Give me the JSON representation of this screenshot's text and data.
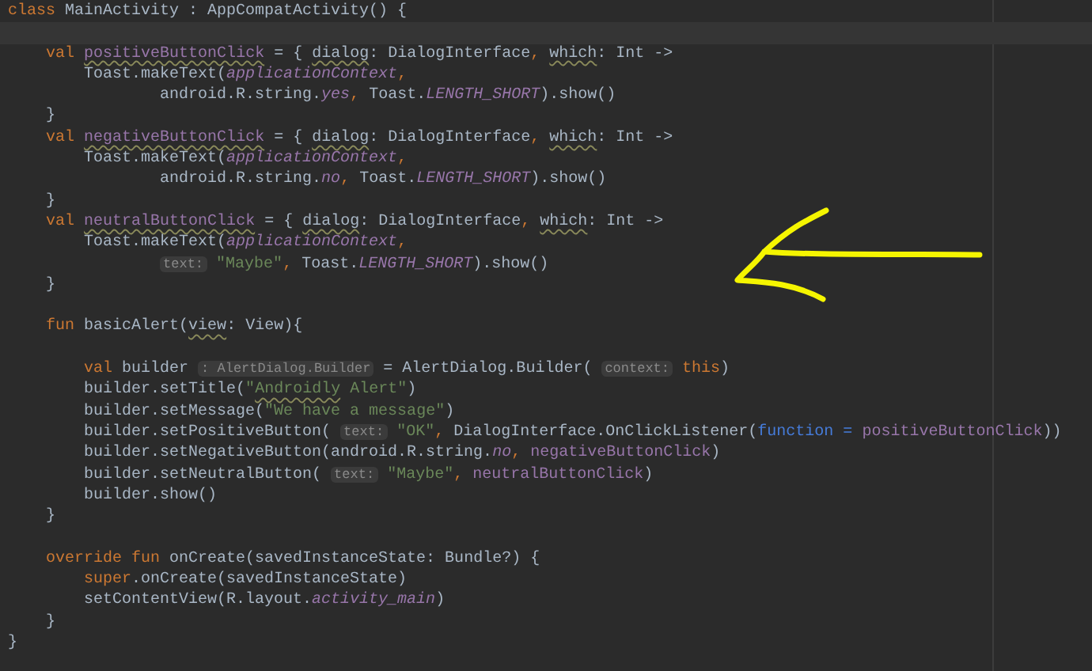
{
  "editor": {
    "lines": [
      {
        "kind": "code",
        "tokens": [
          {
            "kind": "keyword",
            "text": "class",
            "typo": false
          },
          {
            "kind": "plain",
            "text": " MainActivity : AppCompatActivity() {",
            "typo": false
          }
        ]
      },
      {
        "kind": "current"
      },
      {
        "kind": "code",
        "tokens": [
          {
            "kind": "keyword",
            "text": "    val",
            "typo": false
          },
          {
            "kind": "field",
            "text": " positiveButtonClick",
            "typo": true
          },
          {
            "kind": "plain",
            "text": " = { ",
            "typo": false
          },
          {
            "kind": "plain",
            "text": "dialog",
            "typo": true
          },
          {
            "kind": "plain",
            "text": ": DialogInterface",
            "typo": false
          },
          {
            "kind": "keyword",
            "text": ", ",
            "typo": false
          },
          {
            "kind": "plain",
            "text": "which",
            "typo": true
          },
          {
            "kind": "plain",
            "text": ": Int ->",
            "typo": false
          }
        ]
      },
      {
        "kind": "code",
        "tokens": [
          {
            "kind": "plain",
            "text": "        Toast.makeText(",
            "typo": false
          },
          {
            "kind": "field_italic",
            "text": "applicationContext",
            "typo": false
          },
          {
            "kind": "keyword",
            "text": ",",
            "typo": false
          }
        ]
      },
      {
        "kind": "code",
        "tokens": [
          {
            "kind": "plain",
            "text": "                android.R.string.",
            "typo": false
          },
          {
            "kind": "field_italic",
            "text": "yes",
            "typo": false
          },
          {
            "kind": "keyword",
            "text": ",",
            "typo": false
          },
          {
            "kind": "plain",
            "text": " Toast.",
            "typo": false
          },
          {
            "kind": "field_italic",
            "text": "LENGTH_SHORT",
            "typo": false
          },
          {
            "kind": "plain",
            "text": ").show()",
            "typo": false
          }
        ]
      },
      {
        "kind": "code",
        "tokens": [
          {
            "kind": "plain",
            "text": "    }",
            "typo": false
          }
        ]
      },
      {
        "kind": "code",
        "tokens": [
          {
            "kind": "keyword",
            "text": "    val",
            "typo": false
          },
          {
            "kind": "field",
            "text": " negativeButtonClick",
            "typo": true
          },
          {
            "kind": "plain",
            "text": " = { ",
            "typo": false
          },
          {
            "kind": "plain",
            "text": "dialog",
            "typo": true
          },
          {
            "kind": "plain",
            "text": ": DialogInterface",
            "typo": false
          },
          {
            "kind": "keyword",
            "text": ", ",
            "typo": false
          },
          {
            "kind": "plain",
            "text": "which",
            "typo": true
          },
          {
            "kind": "plain",
            "text": ": Int ->",
            "typo": false
          }
        ]
      },
      {
        "kind": "code",
        "tokens": [
          {
            "kind": "plain",
            "text": "        Toast.makeText(",
            "typo": false
          },
          {
            "kind": "field_italic",
            "text": "applicationContext",
            "typo": false
          },
          {
            "kind": "keyword",
            "text": ",",
            "typo": false
          }
        ]
      },
      {
        "kind": "code",
        "tokens": [
          {
            "kind": "plain",
            "text": "                android.R.string.",
            "typo": false
          },
          {
            "kind": "field_italic",
            "text": "no",
            "typo": false
          },
          {
            "kind": "keyword",
            "text": ",",
            "typo": false
          },
          {
            "kind": "plain",
            "text": " Toast.",
            "typo": false
          },
          {
            "kind": "field_italic",
            "text": "LENGTH_SHORT",
            "typo": false
          },
          {
            "kind": "plain",
            "text": ").show()",
            "typo": false
          }
        ]
      },
      {
        "kind": "code",
        "tokens": [
          {
            "kind": "plain",
            "text": "    }",
            "typo": false
          }
        ]
      },
      {
        "kind": "code",
        "tokens": [
          {
            "kind": "keyword",
            "text": "    val",
            "typo": false
          },
          {
            "kind": "field",
            "text": " neutralButtonClick",
            "typo": true
          },
          {
            "kind": "plain",
            "text": " = { ",
            "typo": false
          },
          {
            "kind": "plain",
            "text": "dialog",
            "typo": true
          },
          {
            "kind": "plain",
            "text": ": DialogInterface",
            "typo": false
          },
          {
            "kind": "keyword",
            "text": ", ",
            "typo": false
          },
          {
            "kind": "plain",
            "text": "which",
            "typo": true
          },
          {
            "kind": "plain",
            "text": ": Int ->",
            "typo": false
          }
        ]
      },
      {
        "kind": "code",
        "tokens": [
          {
            "kind": "plain",
            "text": "        Toast.makeText(",
            "typo": false
          },
          {
            "kind": "field_italic",
            "text": "applicationContext",
            "typo": false
          },
          {
            "kind": "keyword",
            "text": ",",
            "typo": false
          }
        ]
      },
      {
        "kind": "code",
        "tokens": [
          {
            "kind": "hint",
            "text": "                text:",
            "typo": false
          },
          {
            "kind": "string",
            "text": " \"Maybe\"",
            "typo": false
          },
          {
            "kind": "keyword",
            "text": ",",
            "typo": false
          },
          {
            "kind": "plain",
            "text": " Toast.",
            "typo": false
          },
          {
            "kind": "field_italic",
            "text": "LENGTH_SHORT",
            "typo": false
          },
          {
            "kind": "plain",
            "text": ").show()",
            "typo": false
          }
        ]
      },
      {
        "kind": "code",
        "tokens": [
          {
            "kind": "plain",
            "text": "    }",
            "typo": false
          }
        ]
      },
      {
        "kind": "blank"
      },
      {
        "kind": "code",
        "tokens": [
          {
            "kind": "keyword",
            "text": "    fun",
            "typo": false
          },
          {
            "kind": "plain",
            "text": " basicAlert(",
            "typo": false
          },
          {
            "kind": "plain",
            "text": "view",
            "typo": true
          },
          {
            "kind": "plain",
            "text": ": View){",
            "typo": false
          }
        ]
      },
      {
        "kind": "blank"
      },
      {
        "kind": "code",
        "tokens": [
          {
            "kind": "keyword",
            "text": "        val",
            "typo": false
          },
          {
            "kind": "plain",
            "text": " builder ",
            "typo": false
          },
          {
            "kind": "hint",
            "text": ": AlertDialog.Builder",
            "typo": false
          },
          {
            "kind": "plain",
            "text": " = AlertDialog.Builder( ",
            "typo": false
          },
          {
            "kind": "hint",
            "text": "context:",
            "typo": false
          },
          {
            "kind": "keyword",
            "text": " this",
            "typo": false
          },
          {
            "kind": "plain",
            "text": ")",
            "typo": false
          }
        ]
      },
      {
        "kind": "code",
        "tokens": [
          {
            "kind": "plain",
            "text": "        builder.setTitle(",
            "typo": false
          },
          {
            "kind": "string",
            "text": "\"",
            "typo": false
          },
          {
            "kind": "string",
            "text": "Androidly",
            "typo": true
          },
          {
            "kind": "string",
            "text": " Alert\"",
            "typo": false
          },
          {
            "kind": "plain",
            "text": ")",
            "typo": false
          }
        ]
      },
      {
        "kind": "code",
        "tokens": [
          {
            "kind": "plain",
            "text": "        builder.setMessage(",
            "typo": false
          },
          {
            "kind": "string",
            "text": "\"We have a message\"",
            "typo": false
          },
          {
            "kind": "plain",
            "text": ")",
            "typo": false
          }
        ]
      },
      {
        "kind": "code",
        "tokens": [
          {
            "kind": "plain",
            "text": "        builder.setPositiveButton( ",
            "typo": false
          },
          {
            "kind": "hint",
            "text": "text:",
            "typo": false
          },
          {
            "kind": "string",
            "text": " \"OK\"",
            "typo": false
          },
          {
            "kind": "keyword",
            "text": ",",
            "typo": false
          },
          {
            "kind": "plain",
            "text": " DialogInterface.OnClickListener(",
            "typo": false
          },
          {
            "kind": "param",
            "text": "function =",
            "typo": false
          },
          {
            "kind": "field",
            "text": " positiveButtonClick",
            "typo": false
          },
          {
            "kind": "plain",
            "text": "))",
            "typo": false
          }
        ]
      },
      {
        "kind": "code",
        "tokens": [
          {
            "kind": "plain",
            "text": "        builder.setNegativeButton(android.R.string.",
            "typo": false
          },
          {
            "kind": "field_italic",
            "text": "no",
            "typo": false
          },
          {
            "kind": "keyword",
            "text": ",",
            "typo": false
          },
          {
            "kind": "field",
            "text": " negativeButtonClick",
            "typo": false
          },
          {
            "kind": "plain",
            "text": ")",
            "typo": false
          }
        ]
      },
      {
        "kind": "code",
        "tokens": [
          {
            "kind": "plain",
            "text": "        builder.setNeutralButton( ",
            "typo": false
          },
          {
            "kind": "hint",
            "text": "text:",
            "typo": false
          },
          {
            "kind": "string",
            "text": " \"Maybe\"",
            "typo": false
          },
          {
            "kind": "keyword",
            "text": ",",
            "typo": false
          },
          {
            "kind": "field",
            "text": " neutralButtonClick",
            "typo": false
          },
          {
            "kind": "plain",
            "text": ")",
            "typo": false
          }
        ]
      },
      {
        "kind": "code",
        "tokens": [
          {
            "kind": "plain",
            "text": "        builder.show()",
            "typo": false
          }
        ]
      },
      {
        "kind": "code",
        "tokens": [
          {
            "kind": "plain",
            "text": "    }",
            "typo": false
          }
        ]
      },
      {
        "kind": "blank"
      },
      {
        "kind": "code",
        "tokens": [
          {
            "kind": "keyword",
            "text": "    override fun",
            "typo": false
          },
          {
            "kind": "plain",
            "text": " onCreate(savedInstanceState: Bundle?) {",
            "typo": false
          }
        ]
      },
      {
        "kind": "code",
        "tokens": [
          {
            "kind": "keyword",
            "text": "        super",
            "typo": false
          },
          {
            "kind": "plain",
            "text": ".onCreate(savedInstanceState)",
            "typo": false
          }
        ]
      },
      {
        "kind": "code",
        "tokens": [
          {
            "kind": "plain",
            "text": "        setContentView(R.layout.",
            "typo": false
          },
          {
            "kind": "field_italic",
            "text": "activity_main",
            "typo": false
          },
          {
            "kind": "plain",
            "text": ")",
            "typo": false
          }
        ]
      },
      {
        "kind": "code",
        "tokens": [
          {
            "kind": "plain",
            "text": "    }",
            "typo": false
          }
        ]
      },
      {
        "kind": "code",
        "tokens": [
          {
            "kind": "plain",
            "text": "}",
            "typo": false
          }
        ]
      }
    ]
  }
}
